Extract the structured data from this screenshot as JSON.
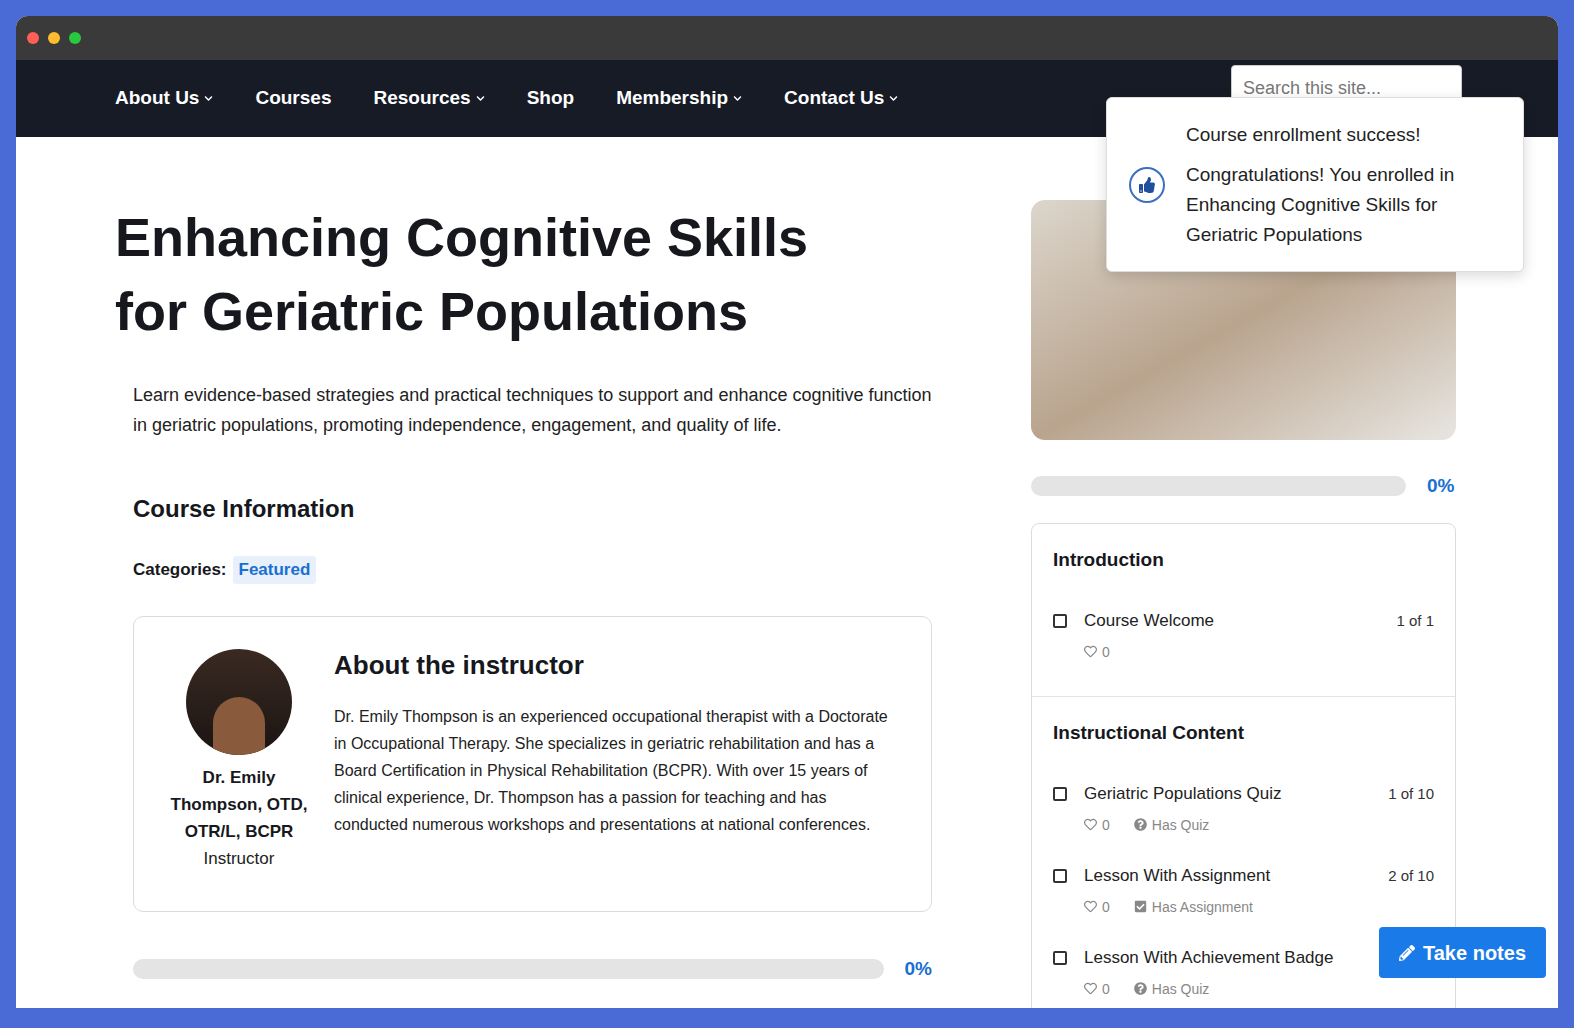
{
  "nav": {
    "items": [
      {
        "label": "About Us",
        "dropdown": true
      },
      {
        "label": "Courses",
        "dropdown": false
      },
      {
        "label": "Resources",
        "dropdown": true
      },
      {
        "label": "Shop",
        "dropdown": false
      },
      {
        "label": "Membership",
        "dropdown": true
      },
      {
        "label": "Contact Us",
        "dropdown": true
      }
    ],
    "search": {
      "placeholder": "Search this site..."
    }
  },
  "toast": {
    "title": "Course enrollment success!",
    "message": "Congratulations! You enrolled in Enhancing Cognitive Skills for Geriatric Populations"
  },
  "course": {
    "title": "Enhancing Cognitive Skills for Geriatric Populations",
    "description": "Learn evidence-based strategies and practical techniques to support and enhance cognitive function in geriatric populations, promoting independence, engagement, and quality of life.",
    "section_heading": "Course Information",
    "categories_label": "Categories:",
    "categories": [
      "Featured"
    ],
    "progress": {
      "level": 0,
      "reading": "0%"
    }
  },
  "instructor": {
    "heading": "About the instructor",
    "name": "Dr. Emily Thompson, OTD, OTR/L, BCPR",
    "role": "Instructor",
    "bio": "Dr. Emily Thompson is an experienced occupational therapist with a Doctorate in Occupational Therapy. She specializes in geriatric rehabilitation and has a Board Certification in Physical Rehabilitation (BCPR). With over 15 years of clinical experience, Dr. Thompson has a passion for teaching and has conducted numerous workshops and presentations at national conferences."
  },
  "sidebar": {
    "progress": {
      "level": 0,
      "reading": "0%"
    },
    "sections": [
      {
        "title": "Introduction",
        "lessons": [
          {
            "title": "Course Welcome",
            "position": "1 of 1",
            "likes": "0",
            "checked": false
          }
        ]
      },
      {
        "title": "Instructional Content",
        "lessons": [
          {
            "title": "Geriatric Populations Quiz",
            "position": "1 of 10",
            "likes": "0",
            "checked": false,
            "badge": {
              "kind": "quiz",
              "label": "Has Quiz"
            }
          },
          {
            "title": "Lesson With Assignment",
            "position": "2 of 10",
            "likes": "0",
            "checked": false,
            "badge": {
              "kind": "assignment",
              "label": "Has Assignment"
            }
          },
          {
            "title": "Lesson With Achievement Badge",
            "likes": "0",
            "checked": false,
            "badge": {
              "kind": "quiz",
              "label": "Has Quiz"
            }
          }
        ]
      }
    ]
  },
  "notes_button": {
    "label": "Take notes"
  }
}
